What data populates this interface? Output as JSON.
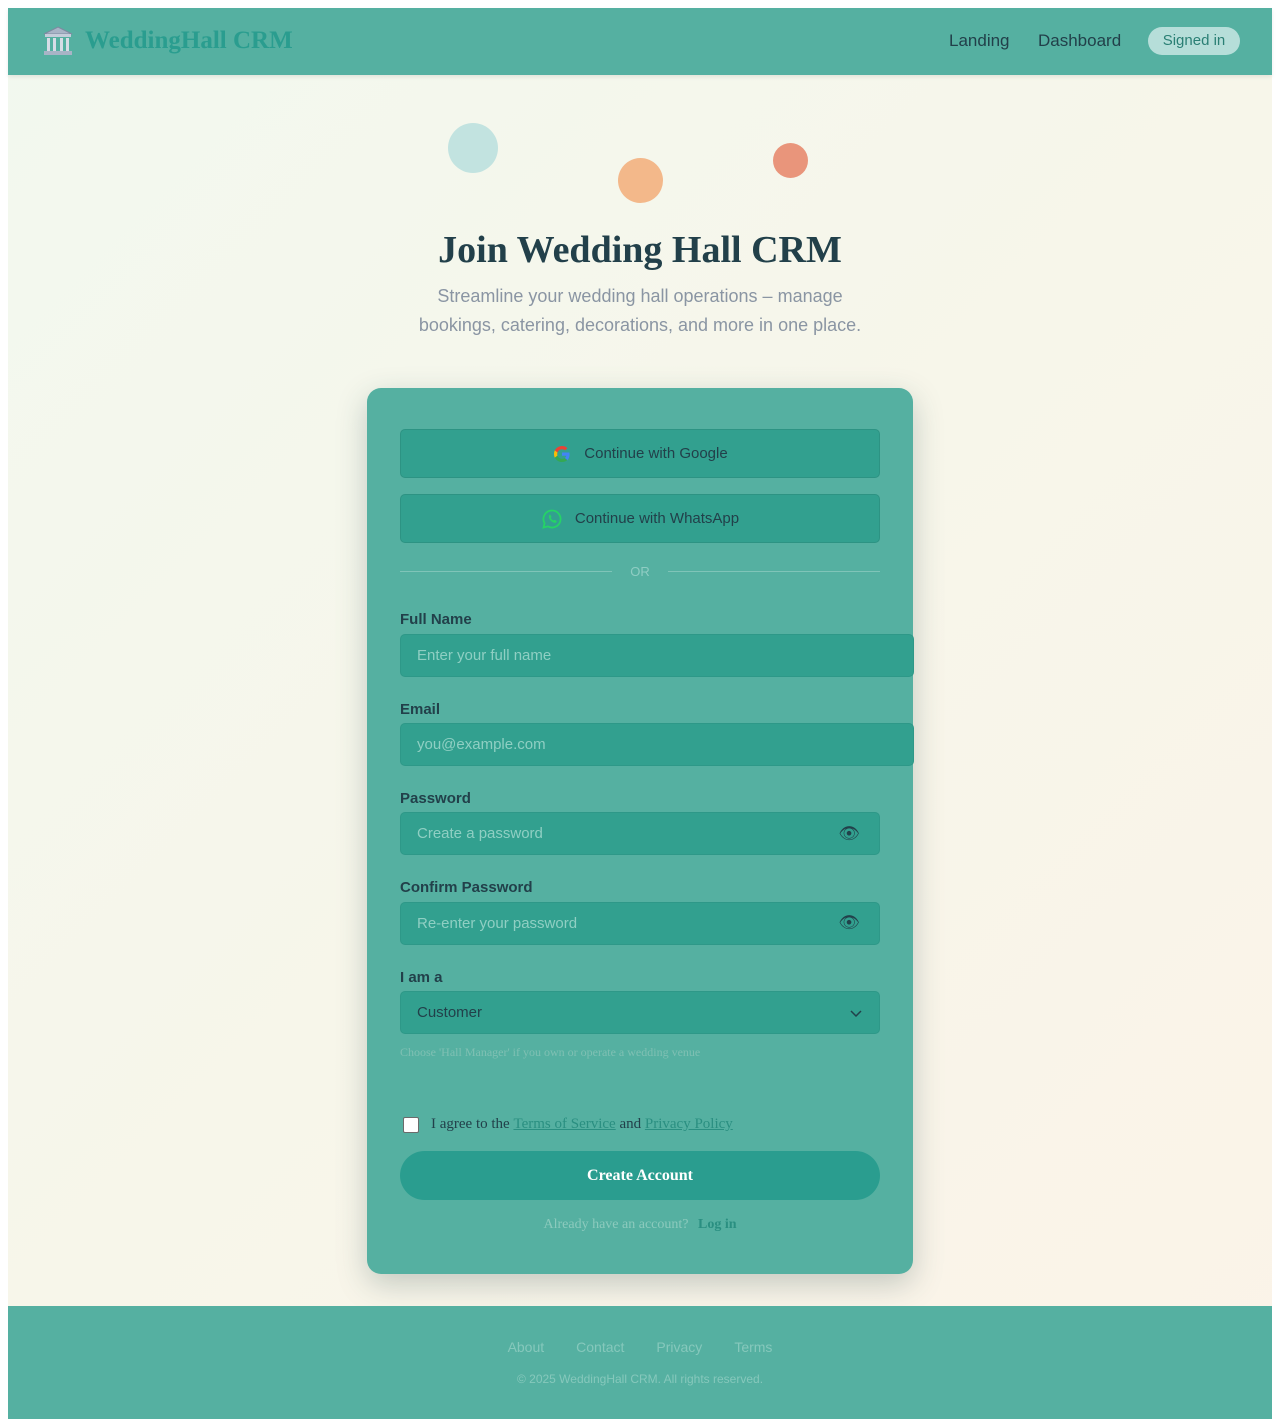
{
  "header": {
    "brand_name": "WeddingHall CRM",
    "nav": [
      "Landing",
      "Dashboard"
    ],
    "status_badge": "Signed in"
  },
  "hero": {
    "title": "Join Wedding Hall CRM",
    "subtitle": "Streamline your wedding hall operations – manage bookings, catering, decorations, and more in one place."
  },
  "signup": {
    "google_label": "Continue with Google",
    "whatsapp_label": "Continue with WhatsApp",
    "divider_text": "OR",
    "full_name": {
      "label": "Full Name",
      "placeholder": "Enter your full name",
      "value": ""
    },
    "email": {
      "label": "Email",
      "placeholder": "you@example.com",
      "value": ""
    },
    "password": {
      "label": "Password",
      "placeholder": "Create a password",
      "value": ""
    },
    "confirm_password": {
      "label": "Confirm Password",
      "placeholder": "Re-enter your password",
      "value": ""
    },
    "role": {
      "label": "I am a",
      "selected": "Customer"
    },
    "role_hint": "Choose 'Hall Manager' if you own or operate a wedding venue",
    "terms": {
      "prefix": "I agree to the",
      "tos": "Terms of Service",
      "and": "and",
      "privacy": "Privacy Policy",
      "checked": false
    },
    "submit_label": "Create Account",
    "login_prompt": "Already have an account?",
    "login_link": "Log in"
  },
  "footer": {
    "links": [
      "About",
      "Contact",
      "Privacy",
      "Terms"
    ],
    "copyright": "© 2025 WeddingHall CRM. All rights reserved."
  },
  "colors": {
    "header_bg": "#55b0a1",
    "accent": "#2a9d8f",
    "card_bg": "#55b0a1",
    "input_bg": "#32a08f",
    "dot_teal": "#c2e3e0",
    "dot_orange": "#f3b88a",
    "dot_coral": "#e9957b"
  },
  "icons": {
    "brand": "classical-building-icon",
    "google": "google-icon",
    "whatsapp": "whatsapp-icon",
    "eye": "eye-icon",
    "chevron": "chevron-down-icon"
  }
}
